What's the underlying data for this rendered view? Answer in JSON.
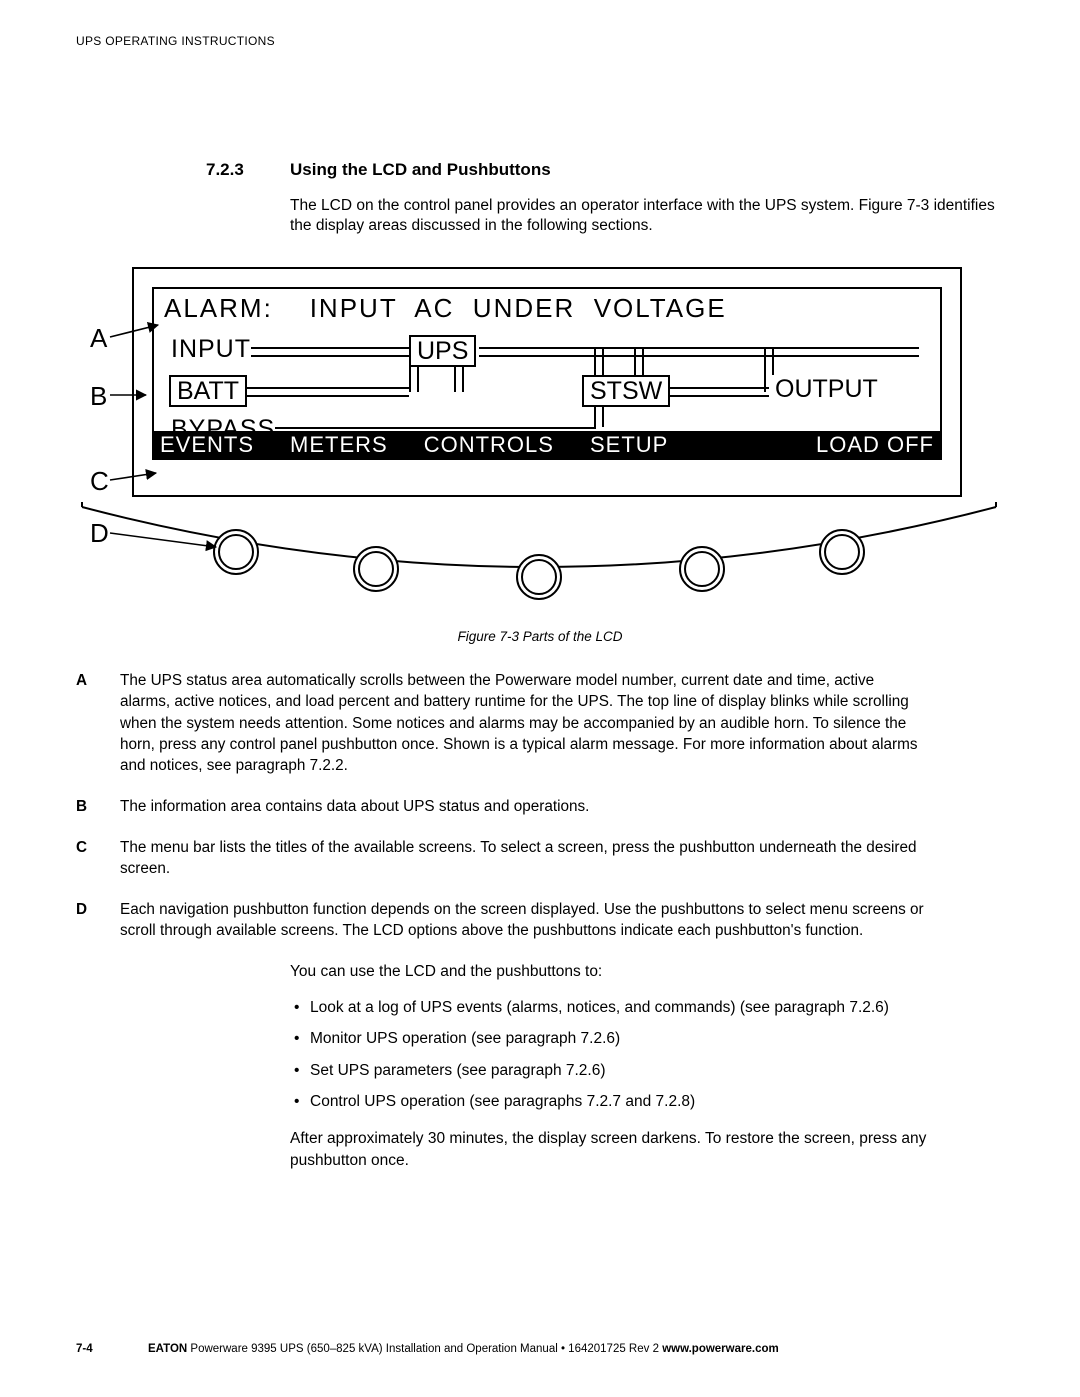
{
  "header": "UPS OPERATING INSTRUCTIONS",
  "section": {
    "number": "7.2.3",
    "title": "Using the LCD and Pushbuttons"
  },
  "intro": "The LCD on the control panel provides an operator interface with the UPS system. Figure 7-3 identifies the display areas discussed in the following sections.",
  "callouts": {
    "A": "A",
    "B": "B",
    "C": "C",
    "D": "D"
  },
  "lcd": {
    "alarm_line": "ALARM:    INPUT  AC  UNDER  VOLTAGE",
    "labels": {
      "input": "INPUT",
      "batt": "BATT",
      "ups": "UPS",
      "stsw": "STSW",
      "output": "OUTPUT",
      "bypass": "BYPASS"
    },
    "menu": {
      "events": "EVENTS",
      "meters": "METERS",
      "controls": "CONTROLS",
      "setup": "SETUP",
      "load_off": "LOAD  OFF"
    }
  },
  "figure_caption": "Figure 7‑3  Parts of the LCD",
  "definitions": [
    {
      "letter": "A",
      "text": "The UPS status area automatically scrolls between the Powerware model number, current date and time, active alarms, active notices, and load percent and battery runtime for the UPS. The top line of display blinks while scrolling when the system needs attention. Some notices and alarms may be accompanied by an audible horn. To silence the horn, press any control panel pushbutton once. Shown is a typical alarm message. For more information about alarms and notices, see paragraph 7.2.2."
    },
    {
      "letter": "B",
      "text": "The information area contains data about UPS status and operations."
    },
    {
      "letter": "C",
      "text": "The menu bar lists the titles of the available screens. To select a screen, press the pushbutton underneath the desired screen."
    },
    {
      "letter": "D",
      "text": "Each navigation pushbutton function depends on the screen displayed. Use the pushbuttons to select menu screens or scroll through available screens. The LCD options above the pushbuttons indicate each pushbutton's function."
    }
  ],
  "body": {
    "lead": "You can use the LCD and the pushbuttons to:",
    "bullets": [
      "Look at a log of UPS events (alarms, notices, and commands) (see paragraph 7.2.6)",
      "Monitor UPS operation (see paragraph 7.2.6)",
      "Set UPS parameters (see paragraph 7.2.6)",
      "Control UPS operation (see paragraphs 7.2.7 and 7.2.8)"
    ],
    "tail": "After approximately 30 minutes, the display screen darkens. To restore the screen, press any pushbutton once."
  },
  "footer": {
    "page": "7-4",
    "brand": "EATON",
    "middle": " Powerware  9395 UPS (650–825 kVA) Installation and Operation Manual  •  164201725 Rev 2 ",
    "url": "www.powerware.com"
  }
}
